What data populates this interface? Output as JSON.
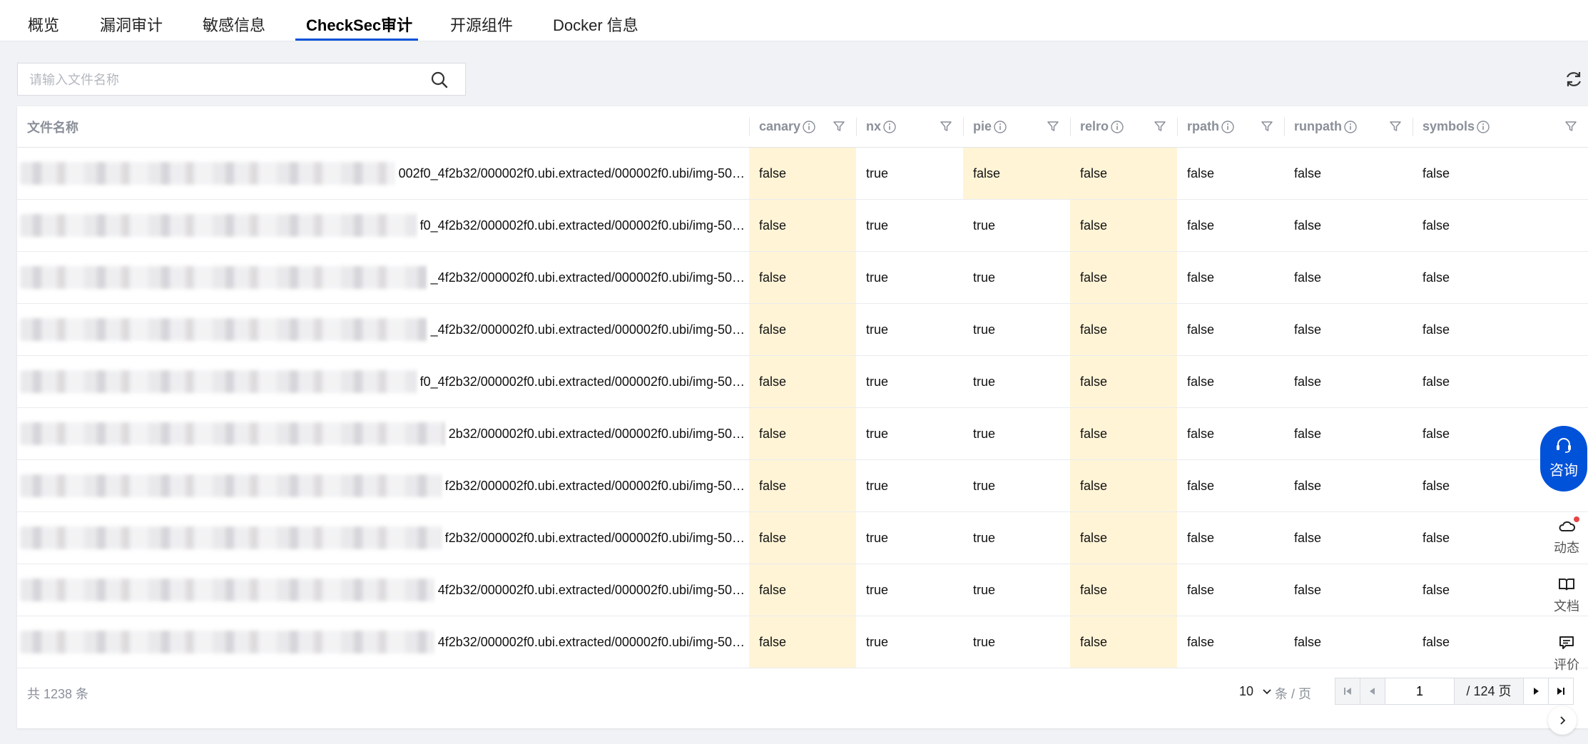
{
  "tabs": [
    {
      "label": "概览"
    },
    {
      "label": "漏洞审计"
    },
    {
      "label": "敏感信息"
    },
    {
      "label": "CheckSec审计",
      "active": true
    },
    {
      "label": "开源组件"
    },
    {
      "label": "Docker 信息"
    }
  ],
  "search": {
    "placeholder": "请输入文件名称",
    "value": ""
  },
  "table": {
    "columns": [
      {
        "label": "文件名称"
      },
      {
        "label": "canary"
      },
      {
        "label": "nx"
      },
      {
        "label": "pie"
      },
      {
        "label": "relro"
      },
      {
        "label": "rpath"
      },
      {
        "label": "runpath"
      },
      {
        "label": "symbols"
      }
    ],
    "rows": [
      {
        "file": "002f0_4f2b32/000002f0.ubi.extracted/000002f0.ubi/img-50…",
        "canary": "false",
        "nx": "true",
        "pie": "false",
        "relro": "false",
        "rpath": "false",
        "runpath": "false",
        "symbols": "false"
      },
      {
        "file": "f0_4f2b32/000002f0.ubi.extracted/000002f0.ubi/img-50…",
        "canary": "false",
        "nx": "true",
        "pie": "true",
        "relro": "false",
        "rpath": "false",
        "runpath": "false",
        "symbols": "false"
      },
      {
        "file": "_4f2b32/000002f0.ubi.extracted/000002f0.ubi/img-50…",
        "canary": "false",
        "nx": "true",
        "pie": "true",
        "relro": "false",
        "rpath": "false",
        "runpath": "false",
        "symbols": "false"
      },
      {
        "file": "_4f2b32/000002f0.ubi.extracted/000002f0.ubi/img-50…",
        "canary": "false",
        "nx": "true",
        "pie": "true",
        "relro": "false",
        "rpath": "false",
        "runpath": "false",
        "symbols": "false"
      },
      {
        "file": "f0_4f2b32/000002f0.ubi.extracted/000002f0.ubi/img-50…",
        "canary": "false",
        "nx": "true",
        "pie": "true",
        "relro": "false",
        "rpath": "false",
        "runpath": "false",
        "symbols": "false"
      },
      {
        "file": "2b32/000002f0.ubi.extracted/000002f0.ubi/img-50…",
        "canary": "false",
        "nx": "true",
        "pie": "true",
        "relro": "false",
        "rpath": "false",
        "runpath": "false",
        "symbols": "false"
      },
      {
        "file": "f2b32/000002f0.ubi.extracted/000002f0.ubi/img-50…",
        "canary": "false",
        "nx": "true",
        "pie": "true",
        "relro": "false",
        "rpath": "false",
        "runpath": "false",
        "symbols": "false"
      },
      {
        "file": "f2b32/000002f0.ubi.extracted/000002f0.ubi/img-50…",
        "canary": "false",
        "nx": "true",
        "pie": "true",
        "relro": "false",
        "rpath": "false",
        "runpath": "false",
        "symbols": "false"
      },
      {
        "file": "4f2b32/000002f0.ubi.extracted/000002f0.ubi/img-50…",
        "canary": "false",
        "nx": "true",
        "pie": "true",
        "relro": "false",
        "rpath": "false",
        "runpath": "false",
        "symbols": "false"
      },
      {
        "file": "4f2b32/000002f0.ubi.extracted/000002f0.ubi/img-50…",
        "canary": "false",
        "nx": "true",
        "pie": "true",
        "relro": "false",
        "rpath": "false",
        "runpath": "false",
        "symbols": "false"
      }
    ],
    "highlight_color": "#fff4d6"
  },
  "pagination": {
    "total_text": "共  1238  条",
    "page_size": "10",
    "per_page_label": "条 / 页",
    "current_page": "1",
    "page_count_text": "/ 124 页"
  },
  "widgets": {
    "consult_label": "咨询",
    "dynamic_label": "动态",
    "docs_label": "文档",
    "review_label": "评价"
  },
  "colors": {
    "accent": "#0052d9",
    "false_highlight": "#fff4d6",
    "badge": "#e54545"
  }
}
